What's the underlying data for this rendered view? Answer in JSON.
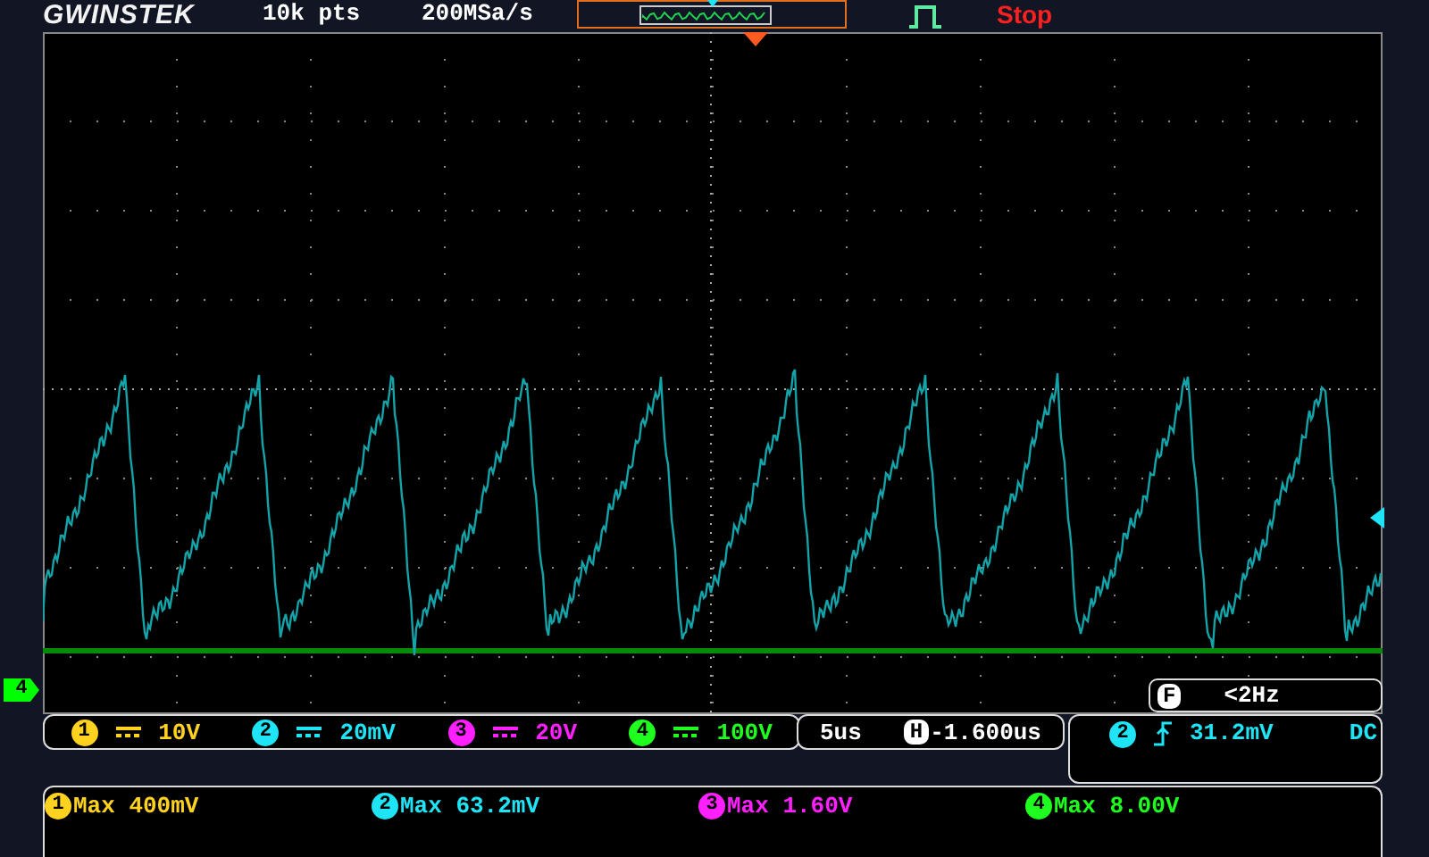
{
  "header": {
    "logo": "GWINSTEK",
    "record_length": "10k pts",
    "sample_rate": "200MSa/s",
    "run_state": "Stop"
  },
  "ground_marker": {
    "label": "4",
    "color": "#00ff00"
  },
  "frequency": {
    "label": "F",
    "value": "<2Hz"
  },
  "channels": [
    {
      "number": "1",
      "scale": "10V",
      "color": "#ffd21f"
    },
    {
      "number": "2",
      "scale": "20mV",
      "color": "#1fe4f5"
    },
    {
      "number": "3",
      "scale": "20V",
      "color": "#ff1fff"
    },
    {
      "number": "4",
      "scale": "100V",
      "color": "#1fff1f"
    }
  ],
  "timebase": {
    "scale": "5us",
    "position_label": "H",
    "position": "-1.600us"
  },
  "trigger": {
    "source": "2",
    "level": "31.2mV",
    "coupling": "DC",
    "color": "#1fe4f5"
  },
  "measurements": [
    {
      "source": "1",
      "text": "Max 400mV",
      "color": "#ffd21f"
    },
    {
      "source": "2",
      "text": "Max 63.2mV",
      "color": "#1fe4f5"
    },
    {
      "source": "3",
      "text": "Max 1.60V",
      "color": "#ff1fff"
    },
    {
      "source": "4",
      "text": "Max 8.00V",
      "color": "#1fff1f"
    }
  ]
}
